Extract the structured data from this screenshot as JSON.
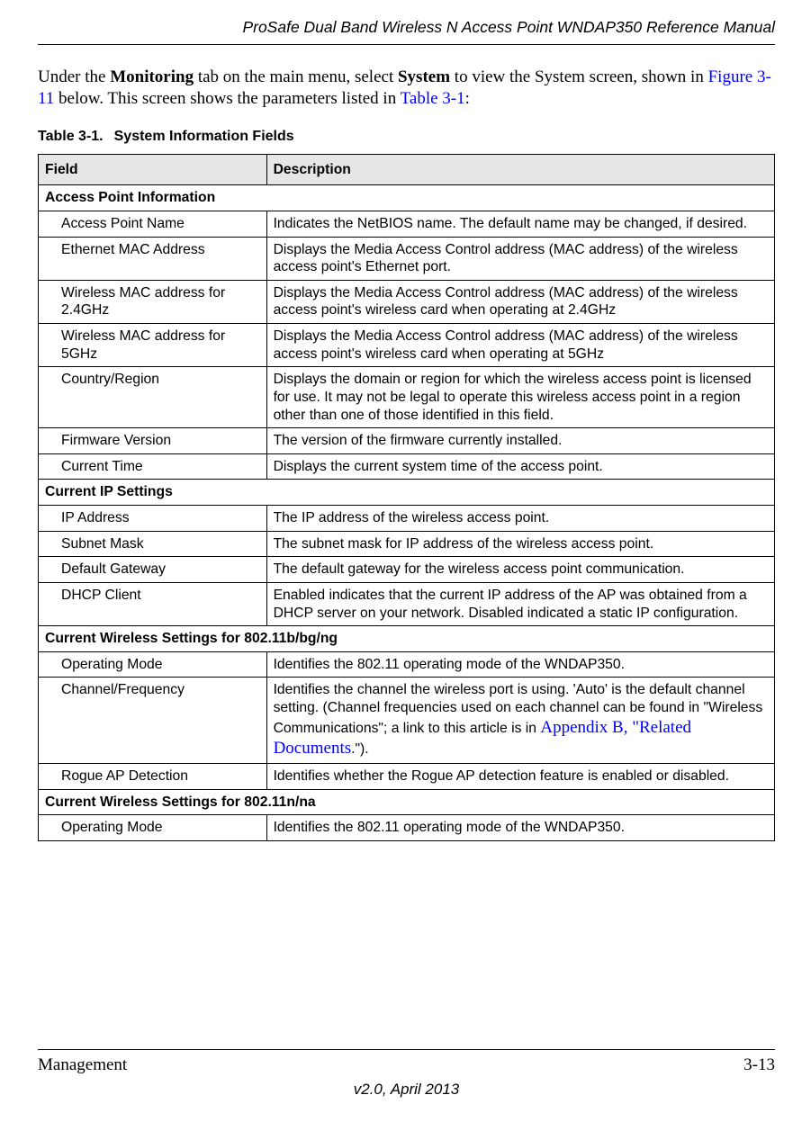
{
  "header": {
    "doc_title": "ProSafe Dual Band Wireless N Access Point WNDAP350 Reference Manual"
  },
  "intro": {
    "pre_bold1": "Under the ",
    "bold1": "Monitoring",
    "mid1": " tab on the main menu, select ",
    "bold2": "System",
    "mid2": " to view the System screen, shown in ",
    "link1": "Figure 3-11",
    "mid3": " below. This screen shows the parameters listed in ",
    "link2": "Table 3-1",
    "tail": ":"
  },
  "table": {
    "caption_num": "Table 3-1.",
    "caption_title": "System Information Fields",
    "head_field": "Field",
    "head_desc": "Description",
    "sections": [
      {
        "title": "Access Point Information",
        "rows": [
          {
            "field": "Access Point Name",
            "desc": "Indicates the NetBIOS name. The default name may be changed, if desired."
          },
          {
            "field": "Ethernet MAC Address",
            "desc": "Displays the Media Access Control address (MAC address) of the wireless access point's Ethernet port."
          },
          {
            "field": "Wireless MAC address for 2.4GHz",
            "desc": "Displays the Media Access Control address (MAC address) of the wireless access point's wireless card when operating at 2.4GHz"
          },
          {
            "field": "Wireless MAC address for 5GHz",
            "desc": "Displays the Media Access Control address (MAC address) of the wireless access point's wireless card when operating at 5GHz"
          },
          {
            "field": "Country/Region",
            "desc": "Displays the domain or region for which the wireless access point is licensed for use. It may not be legal to operate this wireless access point in a region other than one of those identified in this field."
          },
          {
            "field": "Firmware Version",
            "desc": "The version of the firmware currently installed."
          },
          {
            "field": "Current Time",
            "desc": "Displays the current system time of the access point."
          }
        ]
      },
      {
        "title": "Current IP Settings",
        "rows": [
          {
            "field": "IP Address",
            "desc": "The IP address of the wireless access point."
          },
          {
            "field": "Subnet Mask",
            "desc": "The subnet mask for IP address of the wireless access point."
          },
          {
            "field": "Default Gateway",
            "desc": "The default gateway for the wireless access point communication."
          },
          {
            "field": "DHCP Client",
            "desc": "Enabled indicates that the current IP address of the AP was obtained from a DHCP server on your network. Disabled indicated a static IP configuration."
          }
        ]
      },
      {
        "title": "Current Wireless Settings for 802.11b/bg/ng",
        "rows": [
          {
            "field": "Operating Mode",
            "desc": "Identifies the 802.11 operating mode of the WNDAP350."
          },
          {
            "field": "Channel/Frequency",
            "desc_pre": "Identifies the channel the wireless port is using. 'Auto' is the default channel setting. (Channel frequencies used on each channel can be found in \"Wireless Communications\"; a link to this article is in ",
            "desc_link": "Appendix B, \"Related Documents",
            "desc_post": ".\")."
          },
          {
            "field": "Rogue AP Detection",
            "desc": "Identifies whether the Rogue AP detection feature is enabled or disabled."
          }
        ]
      },
      {
        "title": "Current Wireless Settings for 802.11n/na",
        "rows": [
          {
            "field": "Operating Mode",
            "desc": "Identifies the 802.11 operating mode of the WNDAP350."
          }
        ]
      }
    ]
  },
  "footer": {
    "left": "Management",
    "right": "3-13",
    "version": "v2.0, April 2013"
  }
}
